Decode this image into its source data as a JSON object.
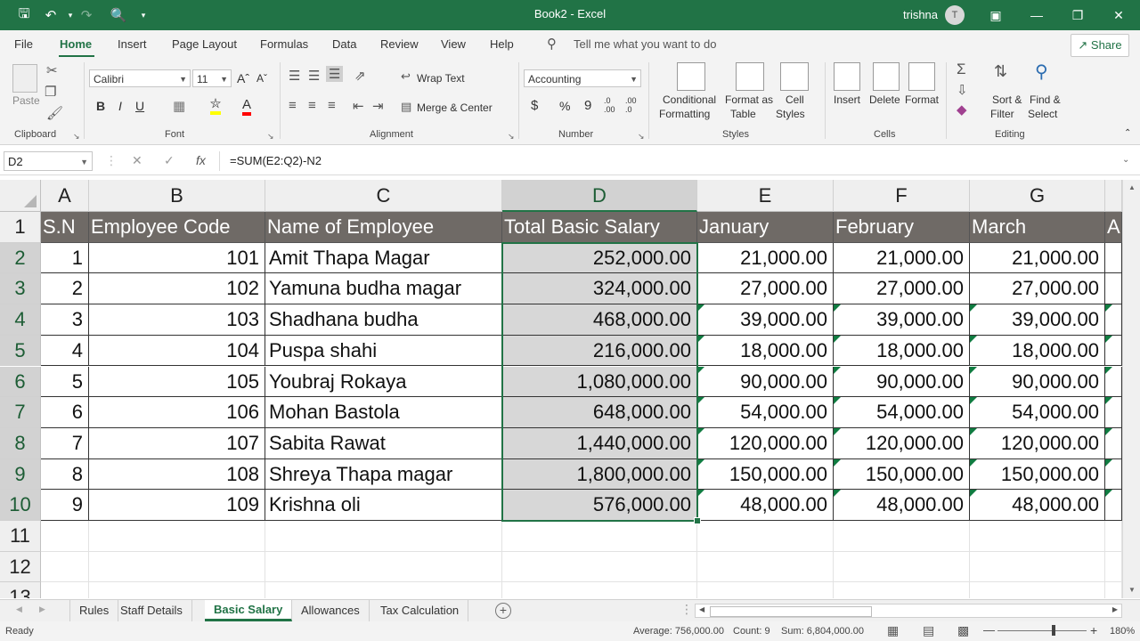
{
  "app": {
    "title": "Book2  -  Excel",
    "user": "trishna",
    "avatar_initial": "T",
    "brand_color": "#217346"
  },
  "ribbon_tabs": [
    "File",
    "Home",
    "Insert",
    "Page Layout",
    "Formulas",
    "Data",
    "Review",
    "View",
    "Help"
  ],
  "tell_me": "Tell me what you want to do",
  "share_label": "Share",
  "ribbon": {
    "clipboard": {
      "label": "Clipboard",
      "paste": "Paste"
    },
    "font": {
      "label": "Font",
      "name": "Calibri",
      "size": "11"
    },
    "alignment": {
      "label": "Alignment",
      "wrap": "Wrap Text",
      "merge": "Merge & Center"
    },
    "number": {
      "label": "Number",
      "format": "Accounting"
    },
    "styles": {
      "label": "Styles",
      "conditional_1": "Conditional",
      "conditional_2": "Formatting",
      "table_1": "Format as",
      "table_2": "Table",
      "cell_1": "Cell",
      "cell_2": "Styles"
    },
    "cells": {
      "label": "Cells",
      "insert": "Insert",
      "delete": "Delete",
      "format": "Format"
    },
    "editing": {
      "label": "Editing",
      "sort_1": "Sort &",
      "sort_2": "Filter",
      "find_1": "Find &",
      "find_2": "Select"
    }
  },
  "formula_bar": {
    "name_box": "D2",
    "formula": "=SUM(E2:Q2)-N2"
  },
  "columns": [
    "A",
    "B",
    "C",
    "D",
    "E",
    "F",
    "G"
  ],
  "row_numbers": [
    "1",
    "2",
    "3",
    "4",
    "5",
    "6",
    "7",
    "8",
    "9",
    "10",
    "11",
    "12",
    "13"
  ],
  "headers": [
    "S.N",
    "Employee Code",
    "Name of Employee",
    "Total Basic Salary",
    "January",
    "February",
    "March",
    "A"
  ],
  "rows": [
    [
      "1",
      "101",
      "Amit Thapa Magar",
      "252,000.00",
      "21,000.00",
      "21,000.00",
      "21,000.00"
    ],
    [
      "2",
      "102",
      "Yamuna budha magar",
      "324,000.00",
      "27,000.00",
      "27,000.00",
      "27,000.00"
    ],
    [
      "3",
      "103",
      "Shadhana budha",
      "468,000.00",
      "39,000.00",
      "39,000.00",
      "39,000.00"
    ],
    [
      "4",
      "104",
      "Puspa shahi",
      "216,000.00",
      "18,000.00",
      "18,000.00",
      "18,000.00"
    ],
    [
      "5",
      "105",
      "Youbraj Rokaya",
      "1,080,000.00",
      "90,000.00",
      "90,000.00",
      "90,000.00"
    ],
    [
      "6",
      "106",
      "Mohan Bastola",
      "648,000.00",
      "54,000.00",
      "54,000.00",
      "54,000.00"
    ],
    [
      "7",
      "107",
      "Sabita Rawat",
      "1,440,000.00",
      "120,000.00",
      "120,000.00",
      "120,000.00"
    ],
    [
      "8",
      "108",
      "Shreya Thapa magar",
      "1,800,000.00",
      "150,000.00",
      "150,000.00",
      "150,000.00"
    ],
    [
      "9",
      "109",
      "Krishna oli",
      "576,000.00",
      "48,000.00",
      "48,000.00",
      "48,000.00"
    ]
  ],
  "sheets": [
    "Rules",
    "Staff Details",
    "Basic Salary",
    "Allowances",
    "Tax Calculation"
  ],
  "active_sheet": "Basic Salary",
  "status": {
    "ready": "Ready",
    "average": "Average: 756,000.00",
    "count": "Count: 9",
    "sum": "Sum: 6,804,000.00",
    "zoom": "180%"
  }
}
